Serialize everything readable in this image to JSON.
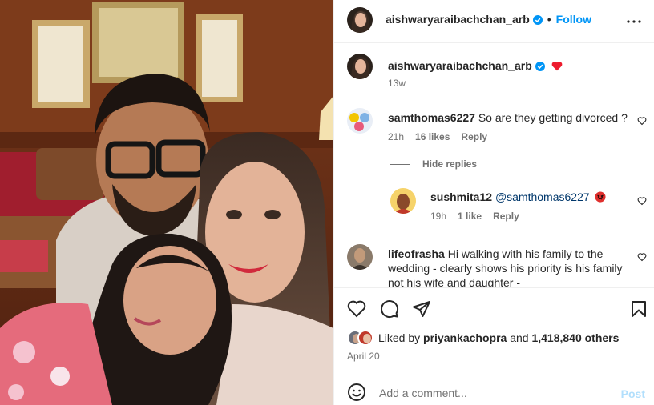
{
  "post": {
    "author": "aishwaryaraibachchan_arb",
    "follow_label": "Follow",
    "separator": "•",
    "caption_emoji": "❤️",
    "age": "13w"
  },
  "comments": [
    {
      "username": "samthomas6227",
      "text": "So are they getting divorced ?",
      "time": "21h",
      "likes": "16 likes",
      "reply_label": "Reply",
      "avatar_icon": "emoji-sticker-avatar"
    },
    {
      "hide_replies_label": "Hide replies",
      "username": "sushmita12",
      "mention": "@samthomas6227",
      "emoji": "angry-face",
      "time": "19h",
      "likes": "1 like",
      "reply_label": "Reply"
    },
    {
      "username": "lifeofrasha",
      "text_line1": "Hi walking with his family to the",
      "text_line2": "wedding - clearly shows his priority is his family",
      "text_line3": "not his wife and daughter -"
    }
  ],
  "actions": {
    "liked_by_prefix": "Liked by",
    "liked_by_user": "priyankachopra",
    "liked_by_and": "and",
    "others_count": "1,418,840 others",
    "date": "April 20"
  },
  "compose": {
    "placeholder": "Add a comment...",
    "post_label": "Post"
  },
  "colors": {
    "accent": "#0095f6",
    "heart": "#ed4956",
    "muted": "#737373"
  }
}
